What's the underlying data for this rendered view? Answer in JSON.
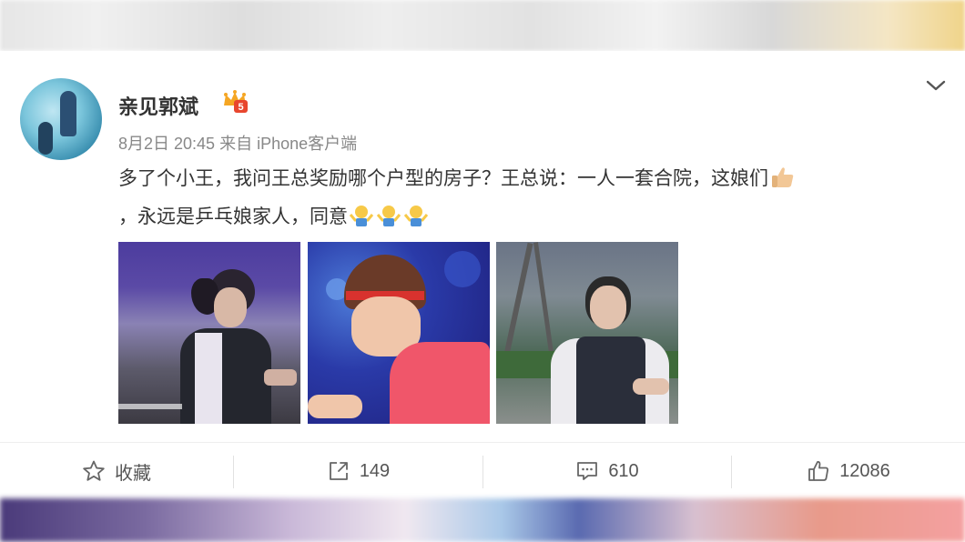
{
  "post": {
    "username": "亲见郭斌",
    "meta": "8月2日 20:45 来自 iPhone客户端",
    "text_line1": "多了个小王，我问王总奖励哪个户型的房子？王总说：一人一套合院，这娘们",
    "text_line2": "，永远是乒乓娘家人，同意"
  },
  "icons": {
    "vip": "vip-crown-badge-icon",
    "more": "chevron-down-icon",
    "thumbs": "thumbs-up-emoji",
    "shrug": "shrug-emoji"
  },
  "actions": {
    "favorite": "收藏",
    "repost": "149",
    "comment": "610",
    "like": "12086"
  },
  "colors": {
    "text": "#333333",
    "meta": "#888888",
    "vip_gold": "#f5a623",
    "vip_red": "#e8462e"
  }
}
